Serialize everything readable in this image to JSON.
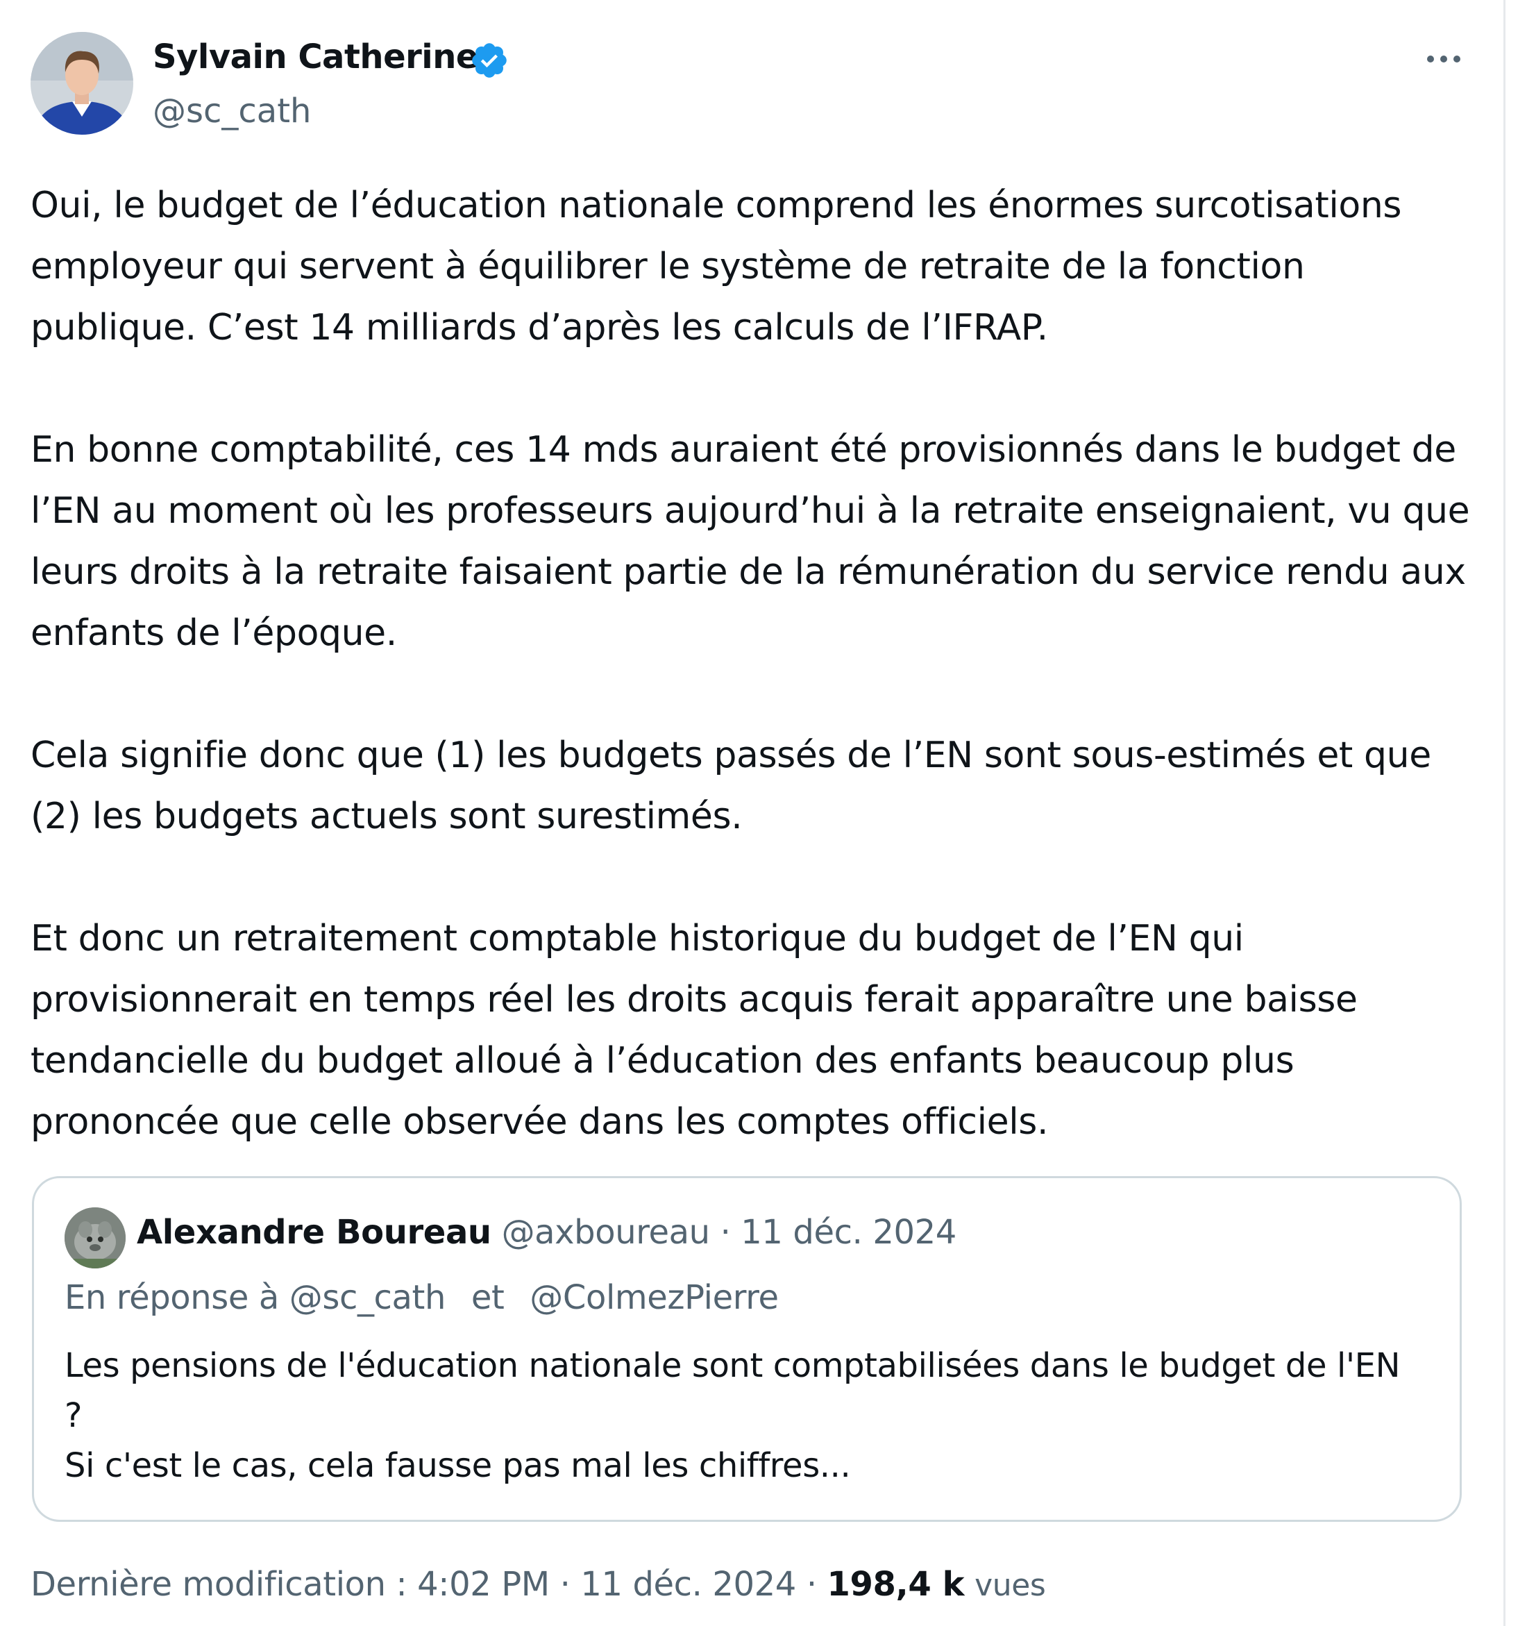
{
  "author": {
    "name": "Sylvain Catherine",
    "handle": "@sc_cath",
    "verified": true
  },
  "tweet": {
    "paragraphs": [
      "Oui, le budget de l’éducation nationale comprend les énormes surcotisations employeur qui servent à équilibrer le système de retraite de la fonction publique. C’est 14 milliards d’après les calculs de l’IFRAP.",
      "En bonne comptabilité, ces 14 mds auraient été provisionnés dans le budget de l’EN au moment où les professeurs aujourd’hui à la retraite enseignaient, vu que leurs droits à la retraite faisaient partie de la rémunération du service rendu aux enfants de l’époque.",
      "Cela signifie donc que (1) les budgets passés de l’EN sont sous-estimés et que (2) les budgets actuels sont surestimés.",
      "Et donc un retraitement comptable historique du budget de l’EN qui provisionnerait en temps réel les droits acquis ferait apparaître une baisse tendancielle du budget alloué à l’éducation des enfants beaucoup plus prononcée que celle observée dans les comptes officiels."
    ]
  },
  "quote": {
    "author_name": "Alexandre Boureau",
    "handle": "@axboureau",
    "separator": "·",
    "date": "11 déc. 2024",
    "reply_prefix": "En réponse à",
    "reply_user_1": "@sc_cath",
    "reply_and": "et",
    "reply_user_2": "@ColmezPierre",
    "text_lines": [
      "Les pensions de l'éducation nationale sont comptabilisées dans le budget de l'EN",
      "?",
      "Si c'est le cas, cela fausse pas mal les chiffres..."
    ]
  },
  "footer": {
    "edited_label": "Dernière modification :",
    "time": "4:02 PM",
    "separator": "·",
    "date": "11 déc. 2024",
    "views_count": "198,4 k",
    "views_label": "vues"
  },
  "colors": {
    "text_primary": "#0f1419",
    "text_secondary": "#536471",
    "verified_blue": "#1d9bf0",
    "border": "#cfd9de"
  },
  "icons": {
    "more": "more-horizontal-icon",
    "verified": "verified-badge-icon"
  }
}
